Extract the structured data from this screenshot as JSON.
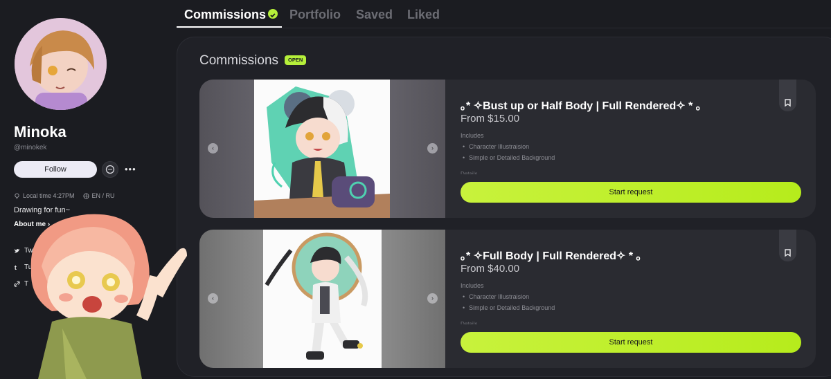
{
  "profile": {
    "name": "Minoka",
    "handle": "@minokek",
    "follow_label": "Follow",
    "more_label": "•••",
    "local_time": "Local time 4:27PM",
    "languages": "EN / RU",
    "bio": "Drawing for fun~",
    "about_label": "About me ›",
    "links": [
      {
        "label": "Twitter",
        "icon": "twitter-icon"
      },
      {
        "label": "Tumblr",
        "icon": "tumblr-icon"
      },
      {
        "label": "T",
        "icon": "link-icon"
      }
    ]
  },
  "tabs": [
    {
      "label": "Commissions",
      "active": true
    },
    {
      "label": "Portfolio",
      "active": false
    },
    {
      "label": "Saved",
      "active": false
    },
    {
      "label": "Liked",
      "active": false
    }
  ],
  "commissions": {
    "heading": "Commissions",
    "status": "OPEN",
    "cards": [
      {
        "title": "｡* ✧Bust up or Half Body | Full Rendered✧ * ｡",
        "price": "From $15.00",
        "includes_label": "Includes",
        "includes": [
          "Character Illustraision",
          "Simple or Detailed Background"
        ],
        "details_label": "Details",
        "button_label": "Start request"
      },
      {
        "title": "｡* ✧Full Body | Full Rendered✧ * ｡",
        "price": "From $40.00",
        "includes_label": "Includes",
        "includes": [
          "Character Illustraision",
          "Simple or Detailed Background"
        ],
        "details_label": "Details",
        "button_label": "Start request"
      }
    ]
  },
  "colors": {
    "accent": "#b5ef3a",
    "background": "#1b1c21",
    "panel": "#202127",
    "card": "#2a2b31"
  }
}
